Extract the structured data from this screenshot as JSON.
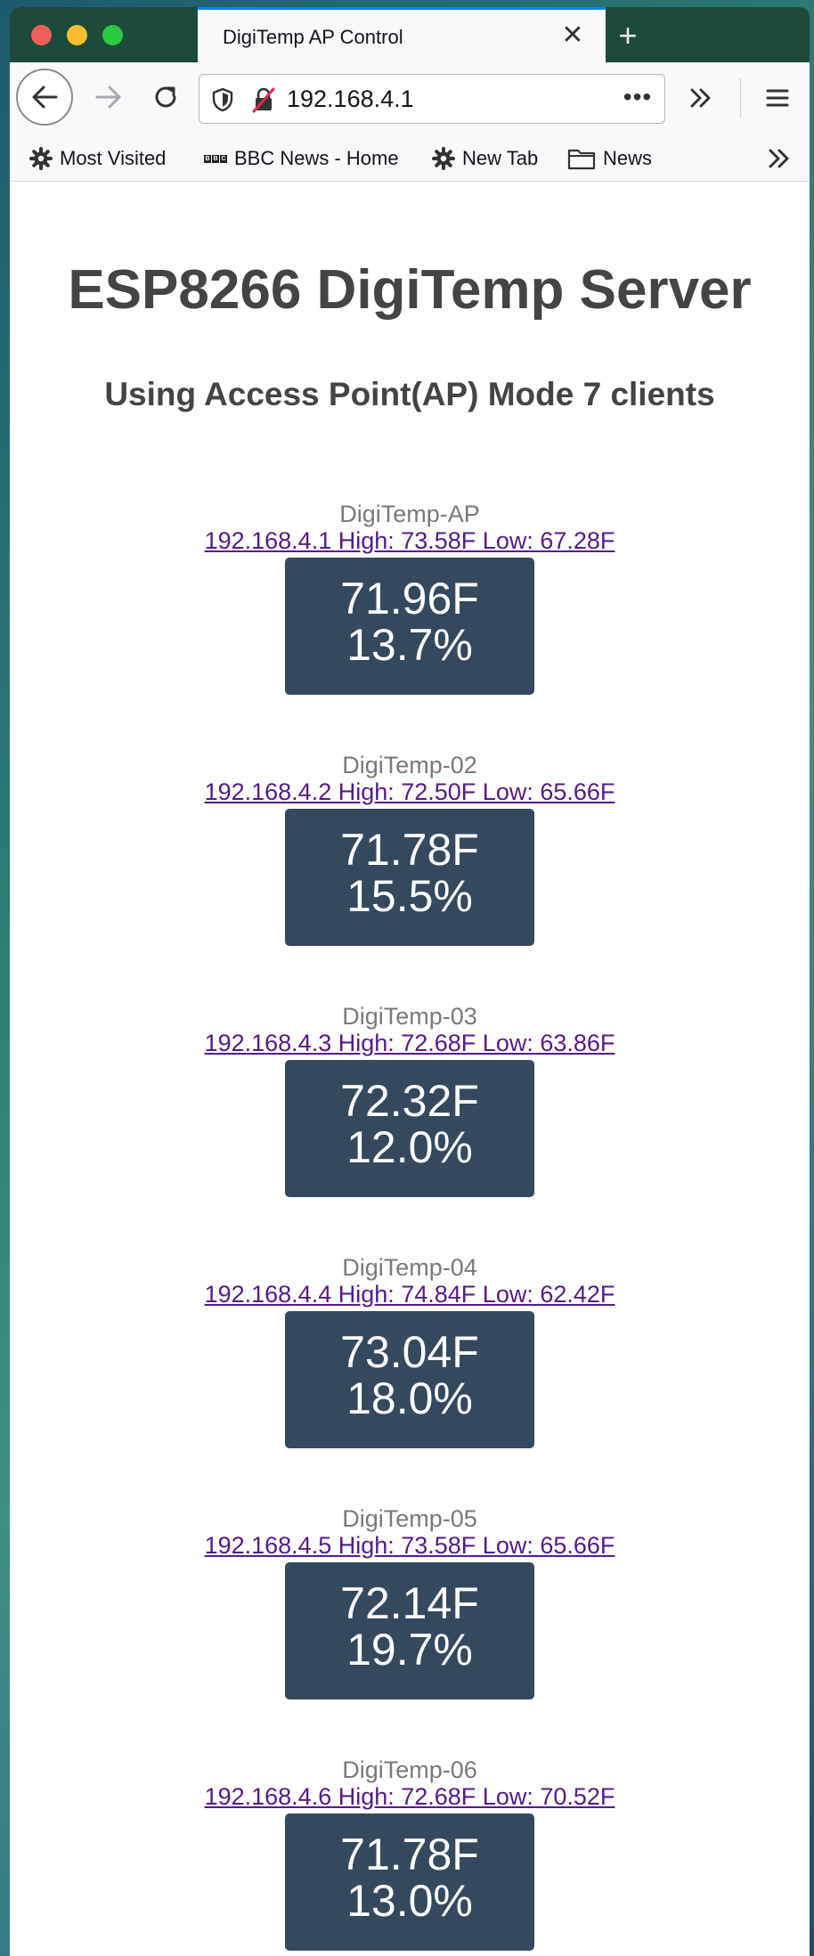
{
  "browser": {
    "tab_title": "DigiTemp AP Control",
    "tab_close_glyph": "✕",
    "new_tab_glyph": "+",
    "url": "192.168.4.1",
    "page_actions_glyph": "•••",
    "bookmarks": [
      {
        "label": "Most Visited",
        "icon": "gear-icon"
      },
      {
        "label": "BBC News - Home",
        "icon": "bbc-icon"
      },
      {
        "label": "New Tab",
        "icon": "gear-icon"
      },
      {
        "label": "News",
        "icon": "folder-icon"
      }
    ],
    "colors": {
      "tab_strip": "#1d4a3a",
      "toolbar": "#f9f9fb",
      "active_tab_accent": "#0a84ff"
    }
  },
  "page": {
    "title": "ESP8266 DigiTemp Server",
    "subtitle": "Using Access Point(AP) Mode 7 clients",
    "sensors": [
      {
        "name": "DigiTemp-AP",
        "link": "192.168.4.1 High: 73.58F Low: 67.28F",
        "temp": "71.96F",
        "humidity": "13.7%"
      },
      {
        "name": "DigiTemp-02",
        "link": "192.168.4.2 High: 72.50F Low: 65.66F",
        "temp": "71.78F",
        "humidity": "15.5%"
      },
      {
        "name": "DigiTemp-03",
        "link": "192.168.4.3 High: 72.68F Low: 63.86F",
        "temp": "72.32F",
        "humidity": "12.0%"
      },
      {
        "name": "DigiTemp-04",
        "link": "192.168.4.4 High: 74.84F Low: 62.42F",
        "temp": "73.04F",
        "humidity": "18.0%"
      },
      {
        "name": "DigiTemp-05",
        "link": "192.168.4.5 High: 73.58F Low: 65.66F",
        "temp": "72.14F",
        "humidity": "19.7%"
      },
      {
        "name": "DigiTemp-06",
        "link": "192.168.4.6 High: 72.68F Low: 70.52F",
        "temp": "71.78F",
        "humidity": "13.0%"
      }
    ],
    "colors": {
      "heading": "#444444",
      "sensor_name": "#7a7a7a",
      "visited_link": "#551a8b",
      "reading_box": "#34495e",
      "reading_text": "#ffffff"
    }
  }
}
